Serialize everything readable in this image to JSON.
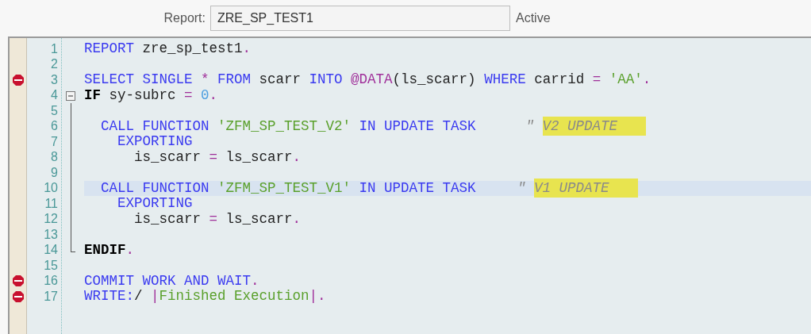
{
  "header": {
    "label": "Report:",
    "report_name": "ZRE_SP_TEST1",
    "status": "Active"
  },
  "editor": {
    "lines": [
      {
        "number": "1",
        "kind": "plain",
        "breakpoint": false,
        "current": false,
        "tokens": [
          {
            "kind": "keyword",
            "text": "REPORT"
          },
          {
            "kind": "plain",
            "text": " zre_sp_test1"
          },
          {
            "kind": "operator",
            "text": "."
          }
        ]
      },
      {
        "number": "2",
        "kind": "plain",
        "breakpoint": false,
        "current": false
      },
      {
        "number": "3",
        "kind": "plain",
        "breakpoint": true,
        "current": false,
        "tokens": [
          {
            "kind": "keyword",
            "text": "SELECT SINGLE "
          },
          {
            "kind": "operator",
            "text": "* "
          },
          {
            "kind": "keyword",
            "text": "FROM "
          },
          {
            "kind": "plain",
            "text": "scarr "
          },
          {
            "kind": "keyword",
            "text": "INTO "
          },
          {
            "kind": "operator",
            "text": "@DATA"
          },
          {
            "kind": "plain",
            "text": "(ls_scarr) "
          },
          {
            "kind": "keyword",
            "text": "WHERE "
          },
          {
            "kind": "plain",
            "text": "carrid "
          },
          {
            "kind": "operator",
            "text": "= "
          },
          {
            "kind": "string",
            "text": "'AA'"
          },
          {
            "kind": "operator",
            "text": "."
          }
        ]
      },
      {
        "number": "4",
        "kind": "foldstart",
        "breakpoint": false,
        "current": false,
        "tokens": [
          {
            "kind": "control",
            "text": "IF"
          },
          {
            "kind": "plain",
            "text": " sy-subrc "
          },
          {
            "kind": "operator",
            "text": "= "
          },
          {
            "kind": "number",
            "text": "0"
          },
          {
            "kind": "operator",
            "text": "."
          }
        ]
      },
      {
        "number": "5",
        "kind": "foldbody",
        "breakpoint": false,
        "current": false
      },
      {
        "number": "6",
        "kind": "foldbody",
        "breakpoint": false,
        "current": false,
        "tokens": [
          {
            "kind": "keyword",
            "text": "  CALL FUNCTION "
          },
          {
            "kind": "string",
            "text": "'ZFM_SP_TEST_V2'"
          },
          {
            "kind": "keyword",
            "text": " IN UPDATE TASK"
          },
          {
            "kind": "comment",
            "text": "      \" "
          },
          {
            "kind": "comment",
            "text": "V2 UPDATE",
            "highlighted": true
          }
        ]
      },
      {
        "number": "7",
        "kind": "foldbody",
        "breakpoint": false,
        "current": false,
        "tokens": [
          {
            "kind": "keyword",
            "text": "    EXPORTING"
          }
        ]
      },
      {
        "number": "8",
        "kind": "foldbody",
        "breakpoint": false,
        "current": false,
        "tokens": [
          {
            "kind": "plain",
            "text": "      is_scarr "
          },
          {
            "kind": "operator",
            "text": "= "
          },
          {
            "kind": "plain",
            "text": "ls_scarr"
          },
          {
            "kind": "operator",
            "text": "."
          }
        ]
      },
      {
        "number": "9",
        "kind": "foldbody",
        "breakpoint": false,
        "current": false
      },
      {
        "number": "10",
        "kind": "foldbody",
        "breakpoint": false,
        "current": true,
        "tokens": [
          {
            "kind": "keyword",
            "text": "  CALL FUNCTION "
          },
          {
            "kind": "string",
            "text": "'ZFM_SP_TEST_V1'"
          },
          {
            "kind": "keyword",
            "text": " IN UPDATE TASK"
          },
          {
            "kind": "comment",
            "text": "     \" "
          },
          {
            "kind": "comment",
            "text": "V1 UPDATE",
            "highlighted": true
          }
        ]
      },
      {
        "number": "11",
        "kind": "foldbody",
        "breakpoint": false,
        "current": false,
        "tokens": [
          {
            "kind": "keyword",
            "text": "    EXPORTING"
          }
        ]
      },
      {
        "number": "12",
        "kind": "foldbody",
        "breakpoint": false,
        "current": false,
        "tokens": [
          {
            "kind": "plain",
            "text": "      is_scarr "
          },
          {
            "kind": "operator",
            "text": "= "
          },
          {
            "kind": "plain",
            "text": "ls_scarr"
          },
          {
            "kind": "operator",
            "text": "."
          }
        ]
      },
      {
        "number": "13",
        "kind": "foldbody",
        "breakpoint": false,
        "current": false
      },
      {
        "number": "14",
        "kind": "foldend",
        "breakpoint": false,
        "current": false,
        "tokens": [
          {
            "kind": "control",
            "text": "ENDIF"
          },
          {
            "kind": "operator",
            "text": "."
          }
        ]
      },
      {
        "number": "15",
        "kind": "plain",
        "breakpoint": false,
        "current": false
      },
      {
        "number": "16",
        "kind": "plain",
        "breakpoint": true,
        "current": false,
        "tokens": [
          {
            "kind": "keyword",
            "text": "COMMIT WORK AND WAIT"
          },
          {
            "kind": "operator",
            "text": "."
          }
        ]
      },
      {
        "number": "17",
        "kind": "plain",
        "breakpoint": true,
        "current": false,
        "tokens": [
          {
            "kind": "keyword",
            "text": "WRITE:"
          },
          {
            "kind": "plain",
            "text": "/ "
          },
          {
            "kind": "operator",
            "text": "|"
          },
          {
            "kind": "string",
            "text": "Finished Execution"
          },
          {
            "kind": "operator",
            "text": "|."
          }
        ]
      }
    ]
  }
}
